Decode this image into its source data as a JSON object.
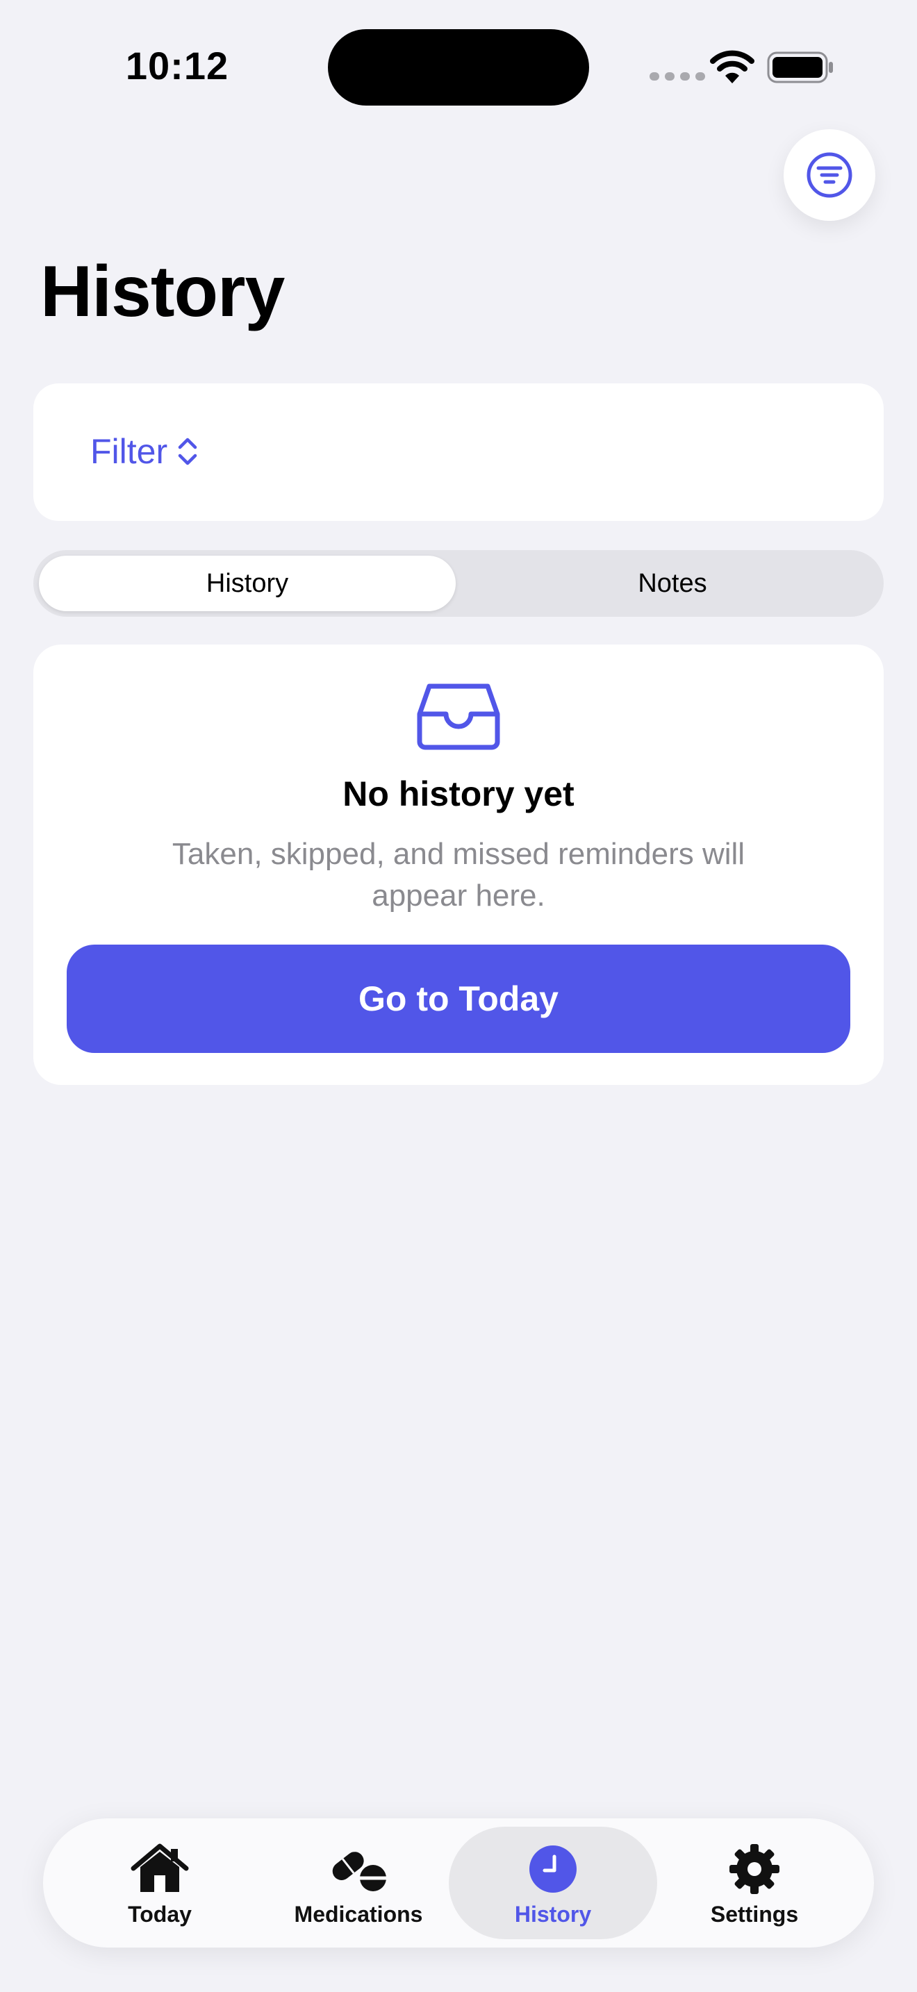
{
  "status_bar": {
    "time": "10:12"
  },
  "header": {
    "title": "History",
    "filter_icon": "filter-lines-icon"
  },
  "filter_card": {
    "label": "Filter",
    "icon": "chevron-up-down-icon"
  },
  "segments": [
    {
      "label": "History",
      "selected": true
    },
    {
      "label": "Notes",
      "selected": false
    }
  ],
  "empty_state": {
    "icon": "inbox-tray-icon",
    "title": "No history yet",
    "subtitle": "Taken, skipped, and missed reminders will appear here.",
    "button_label": "Go to Today"
  },
  "tab_bar": {
    "items": [
      {
        "label": "Today",
        "icon": "house-icon"
      },
      {
        "label": "Medications",
        "icon": "pills-icon"
      },
      {
        "label": "History",
        "icon": "clock-icon",
        "selected": true
      },
      {
        "label": "Settings",
        "icon": "gear-icon"
      }
    ]
  },
  "colors": {
    "accent": "#5156e8",
    "background": "#f2f2f7",
    "muted_text": "#8a8a8f"
  }
}
